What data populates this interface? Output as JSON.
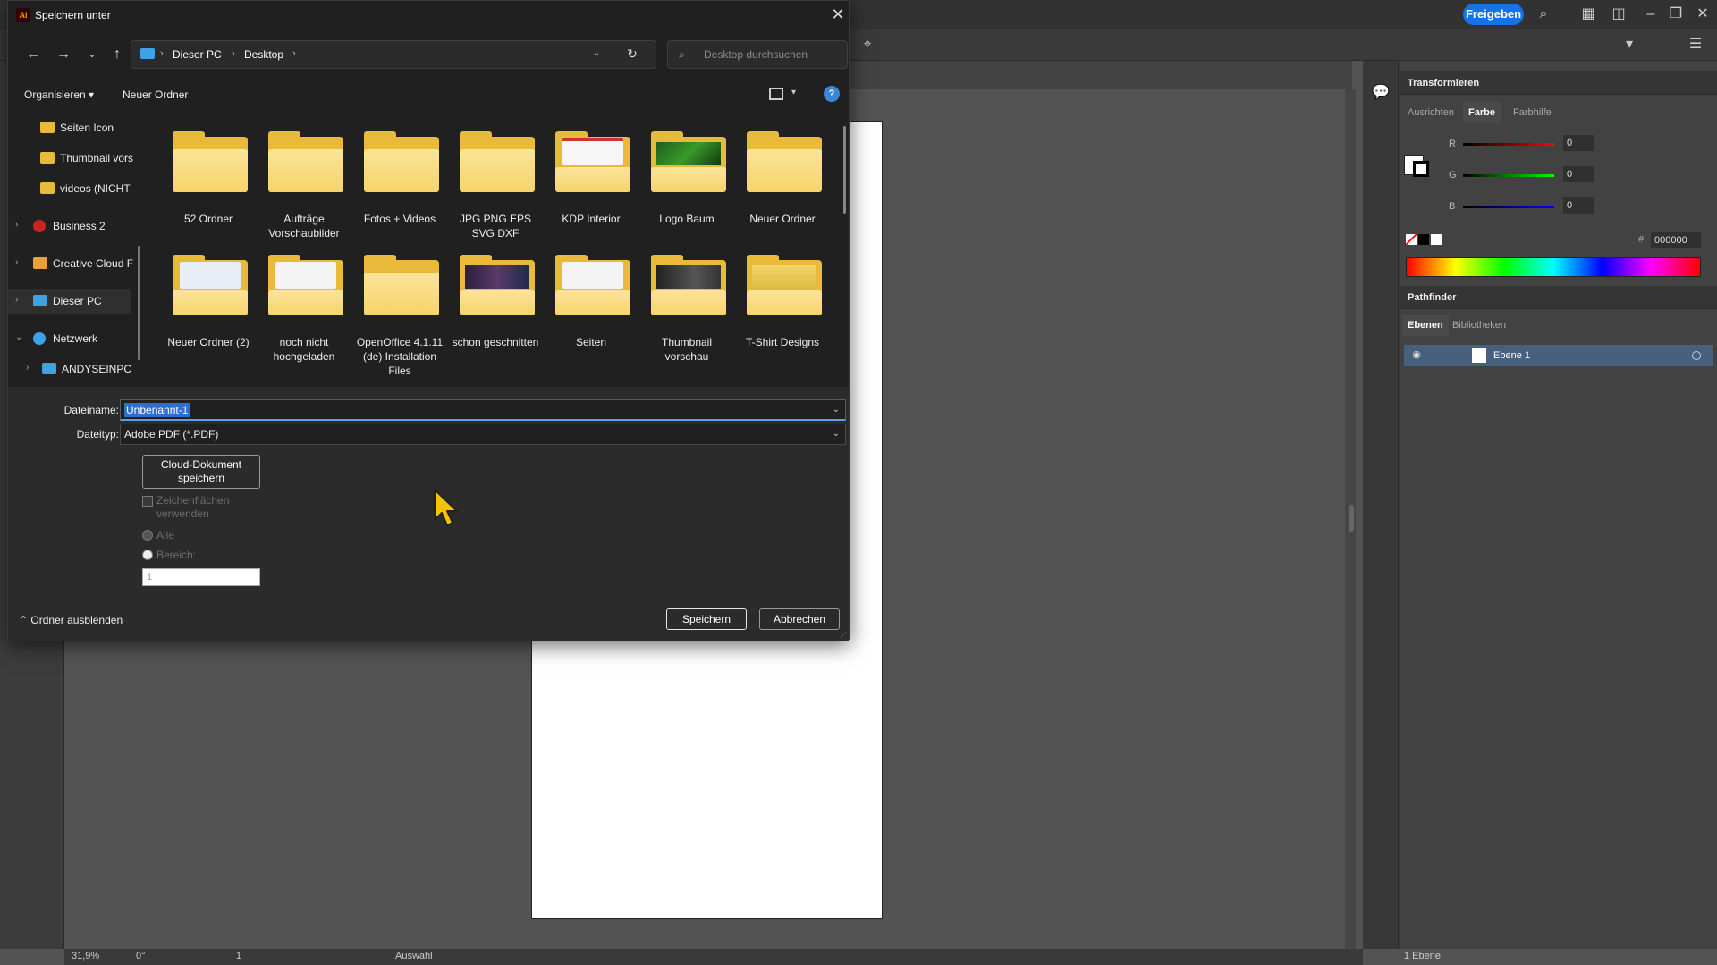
{
  "app": {
    "share_label": "Freigeben",
    "status_zoom": "31,9%",
    "status_angle": "0°",
    "status_page": "1",
    "status_tool": "Auswahl",
    "panels": {
      "transform_title": "Transformieren",
      "tabs_color": [
        "Ausrichten",
        "Farbe",
        "Farbhilfe"
      ],
      "r_label": "R",
      "g_label": "G",
      "b_label": "B",
      "r_val": "0",
      "g_val": "0",
      "b_val": "0",
      "hex_label": "#",
      "hex_val": "000000",
      "pathfinder_title": "Pathfinder",
      "tabs_layers": [
        "Ebenen",
        "Bibliotheken"
      ],
      "layer_name": "Ebene 1",
      "layer_count": "1 Ebene"
    }
  },
  "dialog": {
    "title": "Speichern unter",
    "breadcrumb": [
      "Dieser PC",
      "Desktop"
    ],
    "search_placeholder": "Desktop durchsuchen",
    "organize_label": "Organisieren",
    "new_folder_label": "Neuer Ordner",
    "nav_items": [
      {
        "label": "Seiten Icon",
        "icon": "folder-icon"
      },
      {
        "label": "Thumbnail vors",
        "icon": "folder-icon"
      },
      {
        "label": "videos (NICHT",
        "icon": "folder-icon"
      },
      {
        "label": "Business 2",
        "icon": "user-icon"
      },
      {
        "label": "Creative Cloud F",
        "icon": "cloud-folder-icon"
      },
      {
        "label": "Dieser PC",
        "icon": "computer-icon"
      },
      {
        "label": "Netzwerk",
        "icon": "network-icon"
      },
      {
        "label": "ANDYSEINPC",
        "icon": "computer-icon"
      }
    ],
    "files": [
      {
        "name": "52 Ordner"
      },
      {
        "name": "Aufträge Vorschaubilder"
      },
      {
        "name": "Fotos + Videos"
      },
      {
        "name": "JPG PNG EPS SVG DXF"
      },
      {
        "name": "KDP Interior"
      },
      {
        "name": "Logo Baum"
      },
      {
        "name": "Neuer Ordner"
      },
      {
        "name": "Neuer Ordner (2)"
      },
      {
        "name": "noch nicht hochgeladen"
      },
      {
        "name": "OpenOffice 4.1.11 (de) Installation Files"
      },
      {
        "name": "schon geschnitten"
      },
      {
        "name": "Seiten"
      },
      {
        "name": "Thumbnail vorschau"
      },
      {
        "name": "T-Shirt Designs"
      }
    ],
    "filename_label": "Dateiname:",
    "filename_value": "Unbenannt-1",
    "filetype_label": "Dateityp:",
    "filetype_value": "Adobe PDF (*.PDF)",
    "cloud_button": "Cloud-Dokument speichern",
    "artboards_label": "Zeichenflächen verwenden",
    "radio_all": "Alle",
    "radio_range": "Bereich:",
    "range_value": "1",
    "hide_folders": "Ordner ausblenden",
    "save_button": "Speichern",
    "cancel_button": "Abbrechen"
  }
}
